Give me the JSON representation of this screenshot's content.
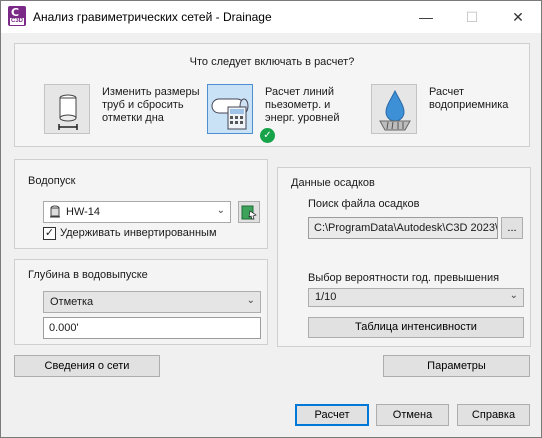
{
  "window": {
    "title": "Анализ гравиметрических сетей - Drainage",
    "icon_text": "C",
    "icon_subtext": "C3D",
    "controls": {
      "minimize": "—",
      "maximize": "☐",
      "close": "✕"
    }
  },
  "calc": {
    "question": "Что следует включать в расчет?",
    "options": [
      {
        "label": "Изменить размеры труб и сбросить отметки дна",
        "icon": "pipe-resize-icon",
        "selected": false
      },
      {
        "label": "Расчет линий пьезометр. и энерг. уровней",
        "icon": "hgl-calculator-icon",
        "selected": true
      },
      {
        "label": "Расчет водоприемника",
        "icon": "inlet-drop-icon",
        "selected": false
      }
    ],
    "selected_badge": "✓"
  },
  "outfall": {
    "title": "Водопуск",
    "selected": "HW-14",
    "hold_invert_label": "Удерживать инвертированным",
    "hold_invert_checked": true,
    "check_mark": "✓"
  },
  "outfall_depth": {
    "title": "Глубина в водовыпуске",
    "mode": "Отметка",
    "value": "0.000'"
  },
  "rainfall": {
    "title": "Данные осадков",
    "file_label": "Поиск файла осадков",
    "file_path": "C:\\ProgramData\\Autodesk\\C3D 2023\\",
    "browse_label": "...",
    "probability_label": "Выбор вероятности год. превышения",
    "probability_value": "1/10",
    "intensity_button": "Таблица интенсивности"
  },
  "buttons": {
    "network_info": "Сведения о сети",
    "parameters": "Параметры",
    "calculate": "Расчет",
    "cancel": "Отмена",
    "help": "Справка"
  },
  "colors": {
    "accent": "#0078d7",
    "selected_fill": "#c9e2f5",
    "success": "#17a34a",
    "app_icon": "#7a2a86"
  }
}
